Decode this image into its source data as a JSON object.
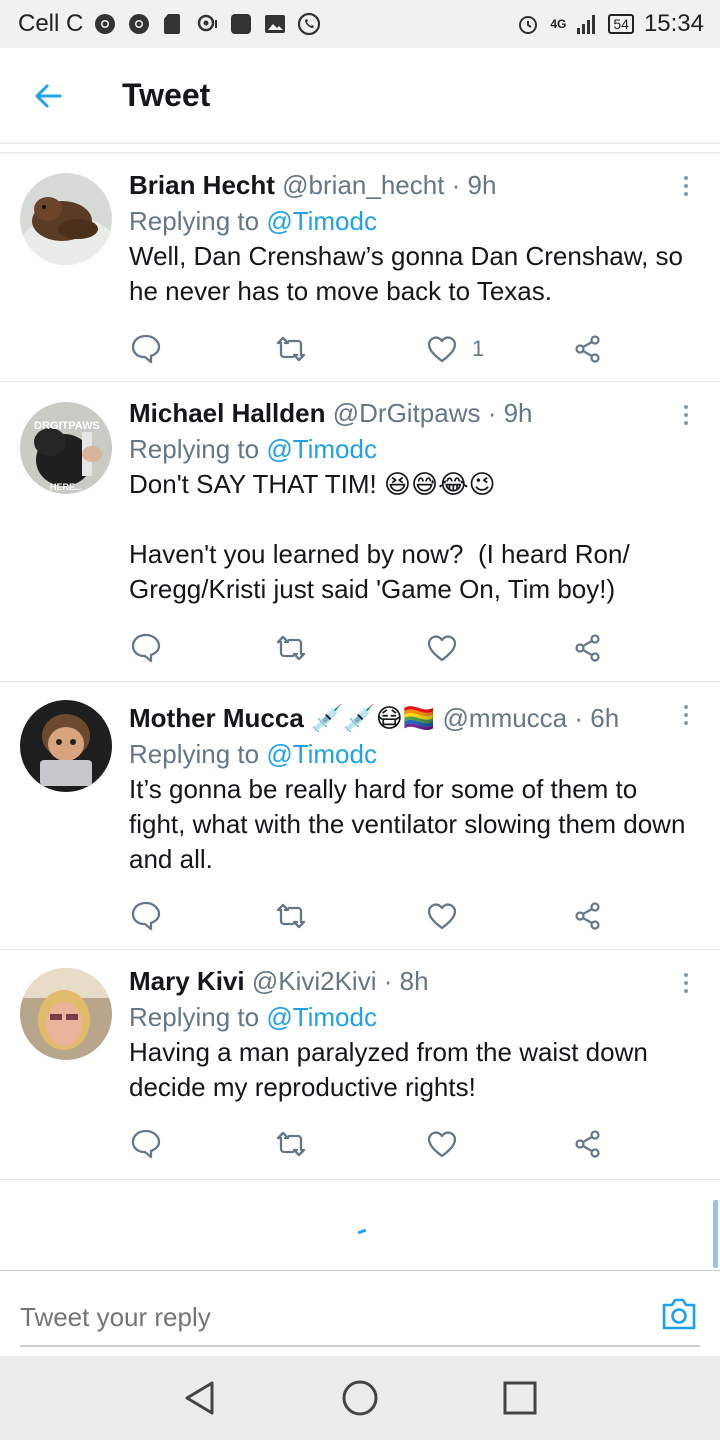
{
  "status_bar": {
    "carrier": "Cell C",
    "network": "4G",
    "battery": "54",
    "time": "15:34"
  },
  "header": {
    "title": "Tweet"
  },
  "tweets": [
    {
      "name": "Brian Hecht",
      "handle": "@brian_hecht",
      "time": "· 9h",
      "replying_prefix": "Replying to ",
      "replying_to": "@Timodc",
      "text": "Well, Dan Crenshaw’s gonna Dan Crenshaw, so he never has to move back to Texas.",
      "likes": "1"
    },
    {
      "name": "Michael Hallden",
      "handle": "@DrGitpaws",
      "time": "· 9h",
      "replying_prefix": "Replying to ",
      "replying_to": "@Timodc",
      "text": "Don't SAY THAT TIM! 😆😅😂😉\n\nHaven't you learned by now?  (I heard Ron/ Gregg/Kristi just said 'Game On, Tim boy!)",
      "likes": "",
      "avatar_text_top": "DRGITPAWS",
      "avatar_text_bottom": "HERE..."
    },
    {
      "name": "Mother Mucca",
      "name_emoji": "💉💉😷🏳️‍🌈",
      "handle": "@mmucca",
      "time": "· 6h",
      "replying_prefix": "Replying to ",
      "replying_to": "@Timodc",
      "text": "It’s gonna be really hard for some of them to fight, what with the ventilator slowing them down and all.",
      "likes": ""
    },
    {
      "name": "Mary Kivi",
      "handle": "@Kivi2Kivi",
      "time": "· 8h",
      "replying_prefix": "Replying to ",
      "replying_to": "@Timodc",
      "text": "Having a man paralyzed from the waist down decide my reproductive rights!",
      "likes": ""
    }
  ],
  "composer": {
    "placeholder": "Tweet your reply"
  },
  "colors": {
    "accent": "#1da1f2",
    "text": "#14171a",
    "muted": "#657786"
  },
  "icons": [
    "back-arrow-icon",
    "more-options-icon",
    "reply-icon",
    "retweet-icon",
    "like-icon",
    "share-icon",
    "camera-icon",
    "nav-back-icon",
    "nav-home-icon",
    "nav-recents-icon"
  ]
}
